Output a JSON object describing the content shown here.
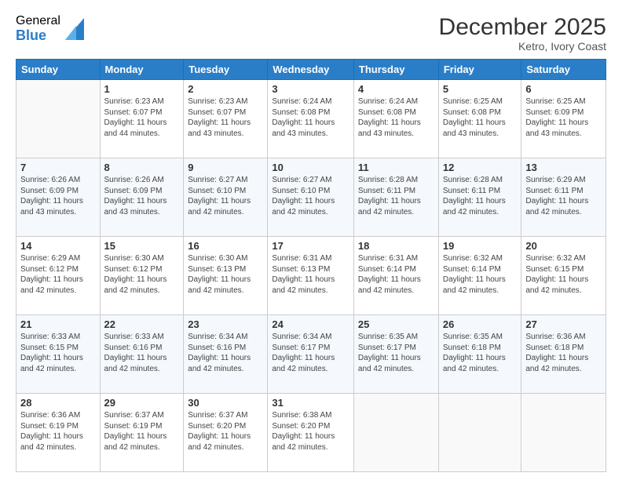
{
  "logo": {
    "general": "General",
    "blue": "Blue"
  },
  "title": "December 2025",
  "subtitle": "Ketro, Ivory Coast",
  "days_of_week": [
    "Sunday",
    "Monday",
    "Tuesday",
    "Wednesday",
    "Thursday",
    "Friday",
    "Saturday"
  ],
  "weeks": [
    [
      {
        "day": "",
        "sunrise": "",
        "sunset": "",
        "daylight": ""
      },
      {
        "day": "1",
        "sunrise": "Sunrise: 6:23 AM",
        "sunset": "Sunset: 6:07 PM",
        "daylight": "Daylight: 11 hours and 44 minutes."
      },
      {
        "day": "2",
        "sunrise": "Sunrise: 6:23 AM",
        "sunset": "Sunset: 6:07 PM",
        "daylight": "Daylight: 11 hours and 43 minutes."
      },
      {
        "day": "3",
        "sunrise": "Sunrise: 6:24 AM",
        "sunset": "Sunset: 6:08 PM",
        "daylight": "Daylight: 11 hours and 43 minutes."
      },
      {
        "day": "4",
        "sunrise": "Sunrise: 6:24 AM",
        "sunset": "Sunset: 6:08 PM",
        "daylight": "Daylight: 11 hours and 43 minutes."
      },
      {
        "day": "5",
        "sunrise": "Sunrise: 6:25 AM",
        "sunset": "Sunset: 6:08 PM",
        "daylight": "Daylight: 11 hours and 43 minutes."
      },
      {
        "day": "6",
        "sunrise": "Sunrise: 6:25 AM",
        "sunset": "Sunset: 6:09 PM",
        "daylight": "Daylight: 11 hours and 43 minutes."
      }
    ],
    [
      {
        "day": "7",
        "sunrise": "",
        "sunset": "",
        "daylight": "Daylight: 11 hours and 43 minutes."
      },
      {
        "day": "8",
        "sunrise": "Sunrise: 6:26 AM",
        "sunset": "Sunset: 6:09 PM",
        "daylight": "Daylight: 11 hours and 43 minutes."
      },
      {
        "day": "9",
        "sunrise": "Sunrise: 6:27 AM",
        "sunset": "Sunset: 6:10 PM",
        "daylight": "Daylight: 11 hours and 42 minutes."
      },
      {
        "day": "10",
        "sunrise": "Sunrise: 6:27 AM",
        "sunset": "Sunset: 6:10 PM",
        "daylight": "Daylight: 11 hours and 42 minutes."
      },
      {
        "day": "11",
        "sunrise": "Sunrise: 6:28 AM",
        "sunset": "Sunset: 6:11 PM",
        "daylight": "Daylight: 11 hours and 42 minutes."
      },
      {
        "day": "12",
        "sunrise": "Sunrise: 6:28 AM",
        "sunset": "Sunset: 6:11 PM",
        "daylight": "Daylight: 11 hours and 42 minutes."
      },
      {
        "day": "13",
        "sunrise": "Sunrise: 6:29 AM",
        "sunset": "Sunset: 6:11 PM",
        "daylight": "Daylight: 11 hours and 42 minutes."
      }
    ],
    [
      {
        "day": "14",
        "sunrise": "",
        "sunset": "",
        "daylight": "Daylight: 11 hours and 42 minutes."
      },
      {
        "day": "15",
        "sunrise": "Sunrise: 6:30 AM",
        "sunset": "Sunset: 6:12 PM",
        "daylight": "Daylight: 11 hours and 42 minutes."
      },
      {
        "day": "16",
        "sunrise": "Sunrise: 6:30 AM",
        "sunset": "Sunset: 6:13 PM",
        "daylight": "Daylight: 11 hours and 42 minutes."
      },
      {
        "day": "17",
        "sunrise": "Sunrise: 6:31 AM",
        "sunset": "Sunset: 6:13 PM",
        "daylight": "Daylight: 11 hours and 42 minutes."
      },
      {
        "day": "18",
        "sunrise": "Sunrise: 6:31 AM",
        "sunset": "Sunset: 6:14 PM",
        "daylight": "Daylight: 11 hours and 42 minutes."
      },
      {
        "day": "19",
        "sunrise": "Sunrise: 6:32 AM",
        "sunset": "Sunset: 6:14 PM",
        "daylight": "Daylight: 11 hours and 42 minutes."
      },
      {
        "day": "20",
        "sunrise": "Sunrise: 6:32 AM",
        "sunset": "Sunset: 6:15 PM",
        "daylight": "Daylight: 11 hours and 42 minutes."
      }
    ],
    [
      {
        "day": "21",
        "sunrise": "",
        "sunset": "",
        "daylight": "Daylight: 11 hours and 42 minutes."
      },
      {
        "day": "22",
        "sunrise": "Sunrise: 6:33 AM",
        "sunset": "Sunset: 6:16 PM",
        "daylight": "Daylight: 11 hours and 42 minutes."
      },
      {
        "day": "23",
        "sunrise": "Sunrise: 6:34 AM",
        "sunset": "Sunset: 6:16 PM",
        "daylight": "Daylight: 11 hours and 42 minutes."
      },
      {
        "day": "24",
        "sunrise": "Sunrise: 6:34 AM",
        "sunset": "Sunset: 6:17 PM",
        "daylight": "Daylight: 11 hours and 42 minutes."
      },
      {
        "day": "25",
        "sunrise": "Sunrise: 6:35 AM",
        "sunset": "Sunset: 6:17 PM",
        "daylight": "Daylight: 11 hours and 42 minutes."
      },
      {
        "day": "26",
        "sunrise": "Sunrise: 6:35 AM",
        "sunset": "Sunset: 6:18 PM",
        "daylight": "Daylight: 11 hours and 42 minutes."
      },
      {
        "day": "27",
        "sunrise": "Sunrise: 6:36 AM",
        "sunset": "Sunset: 6:18 PM",
        "daylight": "Daylight: 11 hours and 42 minutes."
      }
    ],
    [
      {
        "day": "28",
        "sunrise": "Sunrise: 6:36 AM",
        "sunset": "Sunset: 6:19 PM",
        "daylight": "Daylight: 11 hours and 42 minutes."
      },
      {
        "day": "29",
        "sunrise": "Sunrise: 6:37 AM",
        "sunset": "Sunset: 6:19 PM",
        "daylight": "Daylight: 11 hours and 42 minutes."
      },
      {
        "day": "30",
        "sunrise": "Sunrise: 6:37 AM",
        "sunset": "Sunset: 6:20 PM",
        "daylight": "Daylight: 11 hours and 42 minutes."
      },
      {
        "day": "31",
        "sunrise": "Sunrise: 6:38 AM",
        "sunset": "Sunset: 6:20 PM",
        "daylight": "Daylight: 11 hours and 42 minutes."
      },
      {
        "day": "",
        "sunrise": "",
        "sunset": "",
        "daylight": ""
      },
      {
        "day": "",
        "sunrise": "",
        "sunset": "",
        "daylight": ""
      },
      {
        "day": "",
        "sunrise": "",
        "sunset": "",
        "daylight": ""
      }
    ]
  ],
  "week7_daylight": "Daylight: 11 hours and 43 minutes.",
  "week14_daylight": "Daylight: 11 hours and 42 minutes.",
  "week21_daylight": "Daylight: 11 hours and 42 minutes."
}
